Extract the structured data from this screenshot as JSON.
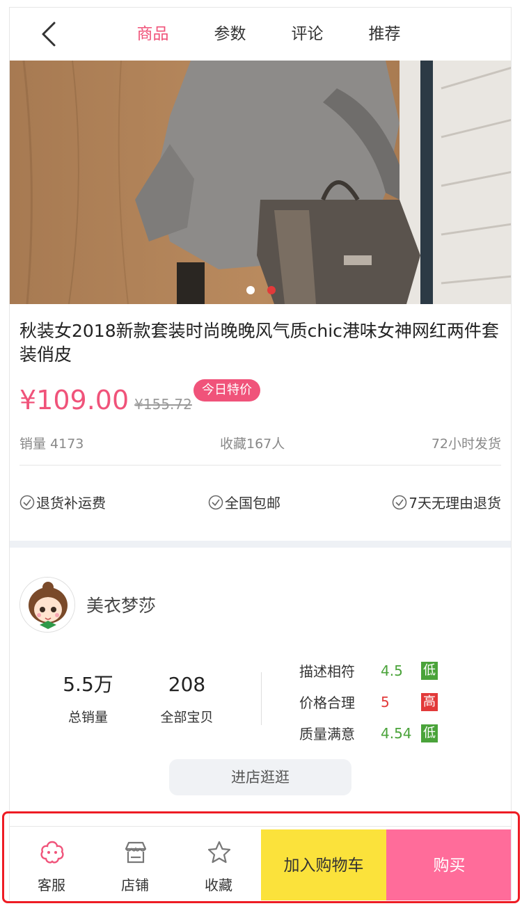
{
  "header": {
    "tabs": [
      {
        "label": "商品",
        "active": true
      },
      {
        "label": "参数",
        "active": false
      },
      {
        "label": "评论",
        "active": false
      },
      {
        "label": "推荐",
        "active": false
      }
    ]
  },
  "product": {
    "title": "秋装女2018新款套装时尚晚晚风气质chic港味女神网红两件套装俏皮",
    "price": "¥109.00",
    "original_price": "¥155.72",
    "promo_badge": "今日特价",
    "sales": "销量 4173",
    "favorites": "收藏167人",
    "shipping": "72小时发货",
    "guarantees": [
      "退货补运费",
      "全国包邮",
      "7天无理由退货"
    ],
    "image_pages": 2,
    "current_image": 2
  },
  "shop": {
    "name": "美衣梦莎",
    "total_sales": "5.5万",
    "total_sales_label": "总销量",
    "item_count": "208",
    "item_count_label": "全部宝贝",
    "ratings": [
      {
        "label": "描述相符",
        "value": "4.5",
        "tag": "低",
        "color": "#4aa33a"
      },
      {
        "label": "价格合理",
        "value": "5",
        "tag": "高",
        "color": "#e23a3a"
      },
      {
        "label": "质量满意",
        "value": "4.54",
        "tag": "低",
        "color": "#4aa33a"
      }
    ],
    "enter_label": "进店逛逛"
  },
  "bottom_bar": {
    "service_label": "客服",
    "store_label": "店铺",
    "favorite_label": "收藏",
    "cart_label": "加入购物车",
    "buy_label": "购买"
  },
  "colors": {
    "accent": "#f0537a",
    "cart": "#fbe23b",
    "buy": "#ff6c9a",
    "highlight": "#ee1c24"
  }
}
